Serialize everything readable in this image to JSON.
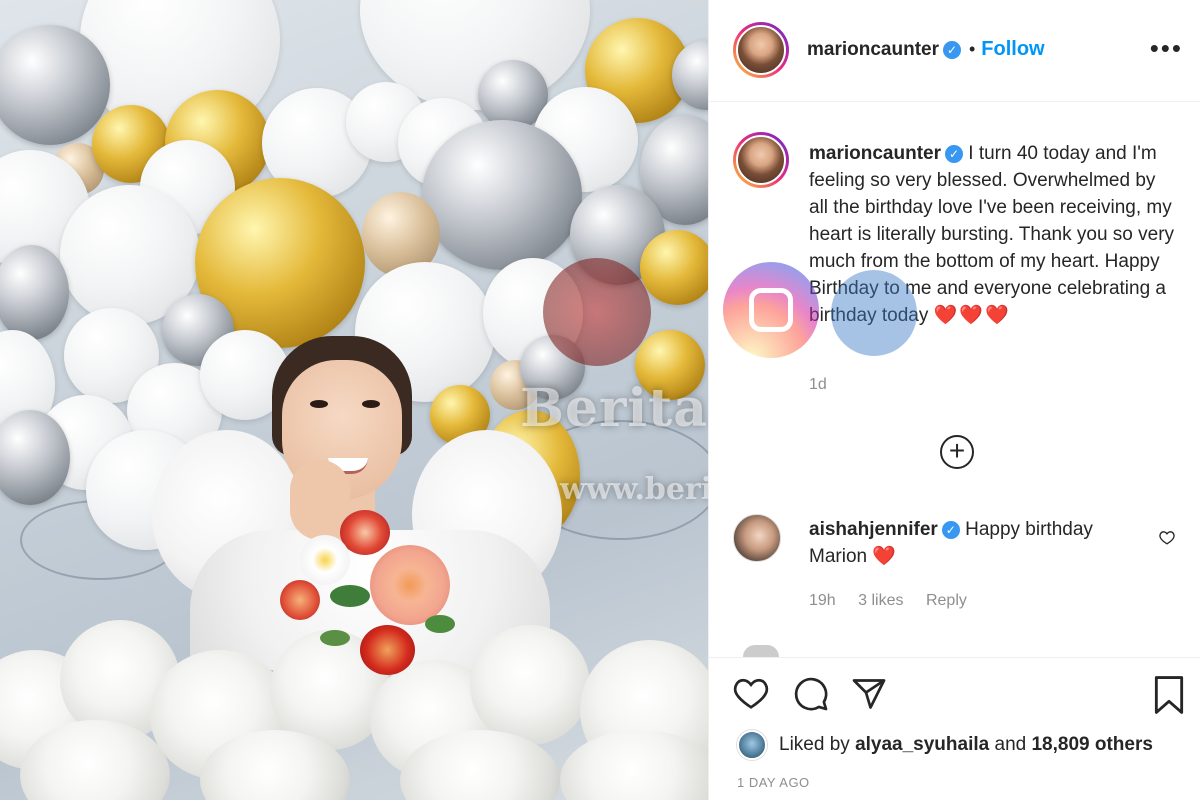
{
  "post": {
    "username": "marioncaunter",
    "follow_label": "Follow",
    "separator": "•",
    "more_label": "•••"
  },
  "caption": {
    "username": "marioncaunter",
    "text": "I turn 40 today and I'm feeling so very blessed. Overwhelmed by all the birthday love I've been receiving, my heart is literally bursting. Thank you so very much from the bottom of my heart. Happy Birthday to me and everyone celebrating a birthday today",
    "emoji": "❤️❤️❤️",
    "time": "1d"
  },
  "comment": {
    "username": "aishahjennifer",
    "text": "Happy birthday Marion",
    "emoji": "❤️",
    "time": "19h",
    "likes": "3 likes",
    "reply_label": "Reply"
  },
  "likes": {
    "prefix": "Liked by",
    "user": "alyaa_syuhaila",
    "suffix": "and",
    "count": "18,809 others"
  },
  "date": "1 DAY AGO",
  "watermark": {
    "title": "Berita Kopak",
    "url": "www.beritakopak.com"
  },
  "colors": {
    "follow": "#0095f6",
    "verified": "#3897f0",
    "heart": "#e0112b",
    "muted": "#8e8e8e"
  }
}
